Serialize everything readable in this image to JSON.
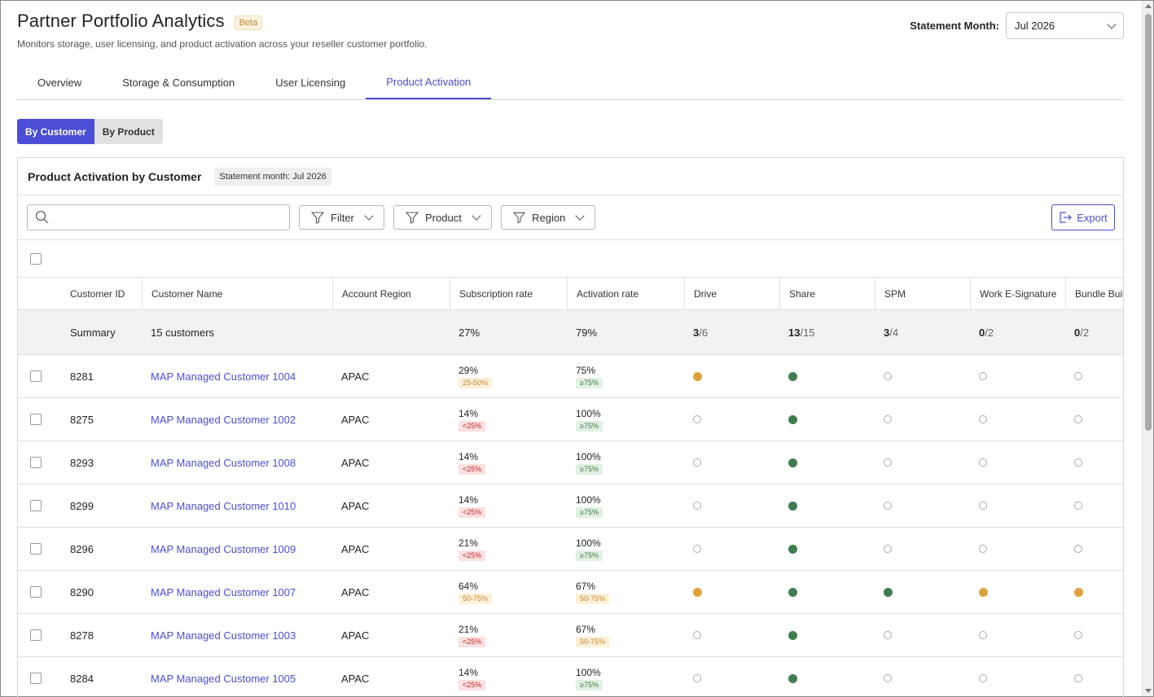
{
  "header": {
    "title": "Partner Portfolio Analytics",
    "badge": "Beta",
    "subtitle": "Monitors storage, user licensing, and product activation across your reseller customer portfolio.",
    "statement_month_label": "Statement Month:",
    "statement_month_value": "Jul 2026"
  },
  "tabs": [
    {
      "label": "Overview",
      "active": false
    },
    {
      "label": "Storage & Consumption",
      "active": false
    },
    {
      "label": "User Licensing",
      "active": false
    },
    {
      "label": "Product Activation",
      "active": true
    }
  ],
  "view_toggle": {
    "by_customer": "By Customer",
    "by_product": "By Product",
    "selected": "By Customer"
  },
  "card": {
    "title": "Product Activation by Customer",
    "chip": "Statement month: Jul 2026"
  },
  "toolbar": {
    "search_placeholder": "",
    "filter_label": "Filter",
    "product_label": "Product",
    "region_label": "Region",
    "export_label": "Export"
  },
  "table": {
    "columns": [
      "Customer ID",
      "Customer Name",
      "Account Region",
      "Subscription rate",
      "Activation rate",
      "Drive",
      "Share",
      "SPM",
      "Work E-Signature",
      "Bundle Builder"
    ],
    "summary": {
      "id": "Summary",
      "name": "15 customers",
      "subscription": "27%",
      "activation": "79%",
      "drive": {
        "n": "3",
        "d": "/6"
      },
      "share": {
        "n": "13",
        "d": "/15"
      },
      "spm": {
        "n": "3",
        "d": "/4"
      },
      "esign": {
        "n": "0",
        "d": "/2"
      },
      "bundle": {
        "n": "0",
        "d": "/2"
      }
    },
    "rows": [
      {
        "id": "8281",
        "name": "MAP Managed Customer 1004",
        "region": "APAC",
        "sub": "29%",
        "sub_badge": "25-50%",
        "sub_tone": "amber",
        "act": "75%",
        "act_badge": "≥75%",
        "act_tone": "green",
        "drive": "orange",
        "share": "green",
        "spm": "empty",
        "esign": "empty",
        "bundle": "empty"
      },
      {
        "id": "8275",
        "name": "MAP Managed Customer 1002",
        "region": "APAC",
        "sub": "14%",
        "sub_badge": "<25%",
        "sub_tone": "red",
        "act": "100%",
        "act_badge": "≥75%",
        "act_tone": "green",
        "drive": "empty",
        "share": "green",
        "spm": "empty",
        "esign": "empty",
        "bundle": "empty"
      },
      {
        "id": "8293",
        "name": "MAP Managed Customer 1008",
        "region": "APAC",
        "sub": "14%",
        "sub_badge": "<25%",
        "sub_tone": "red",
        "act": "100%",
        "act_badge": "≥75%",
        "act_tone": "green",
        "drive": "empty",
        "share": "green",
        "spm": "empty",
        "esign": "empty",
        "bundle": "empty"
      },
      {
        "id": "8299",
        "name": "MAP Managed Customer 1010",
        "region": "APAC",
        "sub": "14%",
        "sub_badge": "<25%",
        "sub_tone": "red",
        "act": "100%",
        "act_badge": "≥75%",
        "act_tone": "green",
        "drive": "empty",
        "share": "green",
        "spm": "empty",
        "esign": "empty",
        "bundle": "empty"
      },
      {
        "id": "8296",
        "name": "MAP Managed Customer 1009",
        "region": "APAC",
        "sub": "21%",
        "sub_badge": "<25%",
        "sub_tone": "red",
        "act": "100%",
        "act_badge": "≥75%",
        "act_tone": "green",
        "drive": "empty",
        "share": "green",
        "spm": "empty",
        "esign": "empty",
        "bundle": "empty"
      },
      {
        "id": "8290",
        "name": "MAP Managed Customer 1007",
        "region": "APAC",
        "sub": "64%",
        "sub_badge": "50-75%",
        "sub_tone": "amber",
        "act": "67%",
        "act_badge": "50-75%",
        "act_tone": "amber",
        "drive": "orange",
        "share": "green",
        "spm": "green",
        "esign": "orange",
        "bundle": "orange"
      },
      {
        "id": "8278",
        "name": "MAP Managed Customer 1003",
        "region": "APAC",
        "sub": "21%",
        "sub_badge": "<25%",
        "sub_tone": "red",
        "act": "67%",
        "act_badge": "50-75%",
        "act_tone": "amber",
        "drive": "empty",
        "share": "green",
        "spm": "empty",
        "esign": "empty",
        "bundle": "empty"
      },
      {
        "id": "8284",
        "name": "MAP Managed Customer 1005",
        "region": "APAC",
        "sub": "14%",
        "sub_badge": "<25%",
        "sub_tone": "red",
        "act": "100%",
        "act_badge": "≥75%",
        "act_tone": "green",
        "drive": "empty",
        "share": "green",
        "spm": "empty",
        "esign": "empty",
        "bundle": "empty"
      }
    ]
  },
  "colors": {
    "accent": "#4b4fd6",
    "status_orange": "#dda23a",
    "status_green": "#3f7d4e"
  }
}
